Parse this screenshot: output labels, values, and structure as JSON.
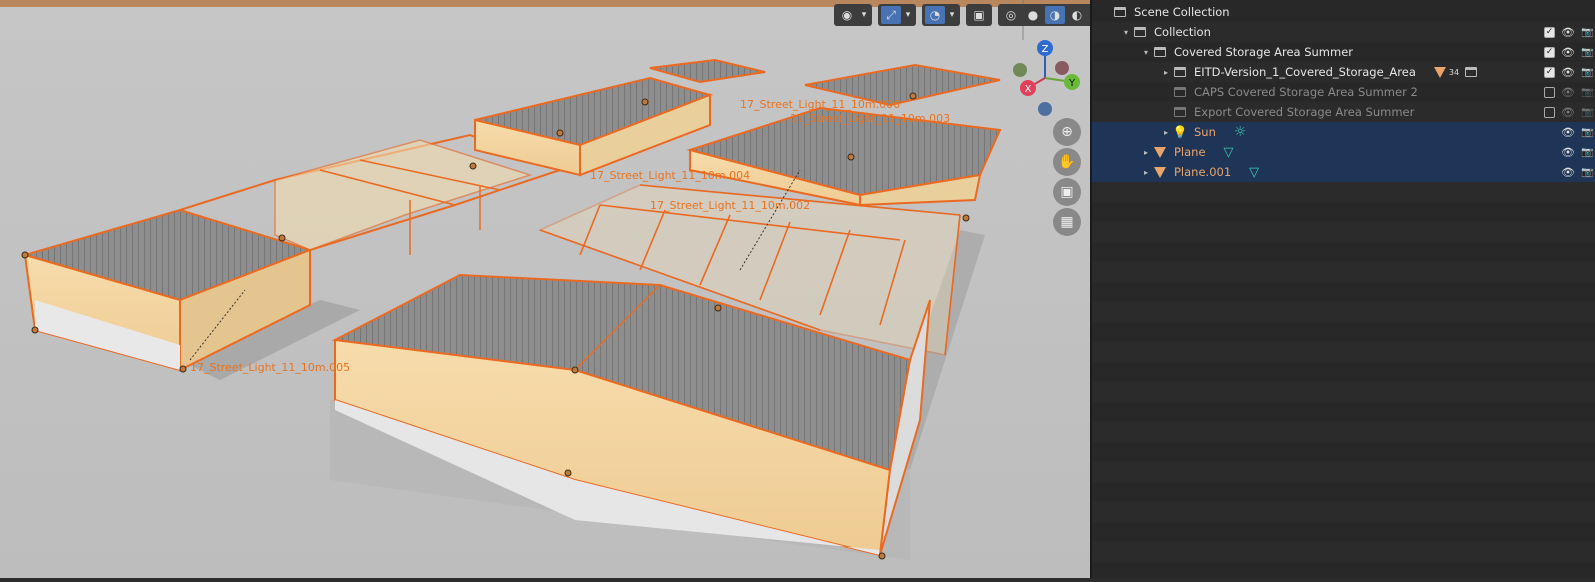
{
  "viewport": {
    "labels": [
      "17_Street_Light_11_10m.005",
      "17_Street_Light_11_10m.004",
      "17_Street_Light_11_10m.006",
      "17_Street_Light_11_10m.002",
      "17_Street_Light_11_10m.003"
    ],
    "gizmo": {
      "z": "Z",
      "y": "Y",
      "x": "X"
    },
    "header_icons": [
      "eye-icon",
      "gizmo-icon",
      "overlay-icon",
      "xray-icon",
      "wireframe-icon",
      "solid-icon",
      "material-icon",
      "rendered-icon"
    ],
    "nav_icons": [
      "zoom-icon",
      "hand-icon",
      "camera-icon",
      "grid-icon"
    ],
    "accent": "#e8731f"
  },
  "outliner": {
    "rows": [
      {
        "label": "Scene Collection",
        "indent": 0,
        "caret": "",
        "type": "scene",
        "check": null
      },
      {
        "label": "Collection",
        "indent": 1,
        "caret": "▾",
        "type": "collection",
        "check": "on"
      },
      {
        "label": "Covered Storage Area Summer",
        "indent": 2,
        "caret": "▾",
        "type": "collection",
        "check": "on"
      },
      {
        "label": "EITD-Version_1_Covered_Storage_Area",
        "indent": 3,
        "caret": "▸",
        "type": "collection",
        "check": "on",
        "badge_count": "34"
      },
      {
        "label": "CAPS Covered Storage Area Summer 2",
        "indent": 3,
        "caret": "",
        "type": "collection",
        "check": "off",
        "dim": true
      },
      {
        "label": "Export Covered Storage Area Summer",
        "indent": 3,
        "caret": "",
        "type": "collection",
        "check": "off",
        "dim": true
      },
      {
        "label": "Sun",
        "indent": 3,
        "caret": "▸",
        "type": "light",
        "check": null,
        "selected": true
      },
      {
        "label": "Plane",
        "indent": 2,
        "caret": "▸",
        "type": "mesh",
        "check": null,
        "selected": true
      },
      {
        "label": "Plane.001",
        "indent": 2,
        "caret": "▸",
        "type": "mesh",
        "check": null,
        "selected": true
      }
    ]
  }
}
